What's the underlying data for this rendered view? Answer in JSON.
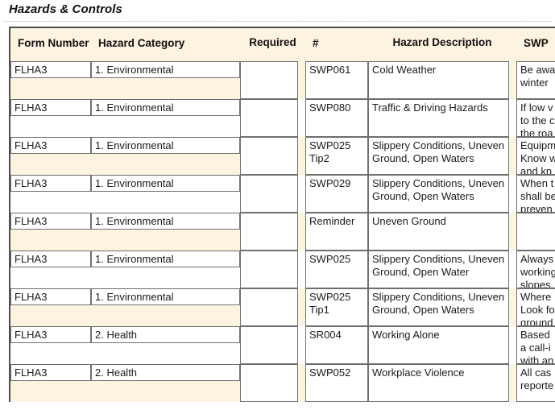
{
  "section": {
    "title": "Hazards & Controls"
  },
  "theme": {
    "header_background": "#FDF3E1",
    "band_background": "#FDF3E1",
    "cell_border": "#717171",
    "table_border": "#4F4F4F",
    "text": "#1B1B1B"
  },
  "table": {
    "columns": [
      {
        "key": "form_number",
        "label": "Form\nNumber",
        "align": "left"
      },
      {
        "key": "hazard_category",
        "label": "Hazard Category",
        "align": "left"
      },
      {
        "key": "required",
        "label": "Required",
        "align": "center"
      },
      {
        "key": "number",
        "label": "#",
        "align": "left"
      },
      {
        "key": "hazard_description",
        "label": "Hazard Description",
        "align": "center"
      },
      {
        "key": "swp",
        "label": "SWP",
        "align": "left"
      }
    ],
    "rows": [
      {
        "form_number": "FLHA3",
        "hazard_category": "1. Environmental",
        "required": "",
        "number": "SWP061",
        "hazard_description": "Cold Weather",
        "swp": "Be awa\nwinter "
      },
      {
        "form_number": "FLHA3",
        "hazard_category": "1. Environmental",
        "required": "",
        "number": "SWP080",
        "hazard_description": "Traffic & Driving Hazards",
        "swp": "If low v\nto the c\nthe roa"
      },
      {
        "form_number": "FLHA3",
        "hazard_category": "1. Environmental",
        "required": "",
        "number": "SWP025 Tip2",
        "hazard_description": "Slippery Conditions, Uneven Ground, Open Waters",
        "swp": "Equipm\nKnow w\nand kn"
      },
      {
        "form_number": "FLHA3",
        "hazard_category": "1. Environmental",
        "required": "",
        "number": "SWP029",
        "hazard_description": "Slippery Conditions, Uneven Ground, Open Waters",
        "swp": "When t\nshall be\npreven"
      },
      {
        "form_number": "FLHA3",
        "hazard_category": "1. Environmental",
        "required": "",
        "number": "Reminder",
        "hazard_description": "Uneven Ground",
        "swp": ""
      },
      {
        "form_number": "FLHA3",
        "hazard_category": "1. Environmental",
        "required": "",
        "number": "SWP025",
        "hazard_description": "Slippery Conditions, Uneven Ground, Open Water",
        "swp": "Always\nworking\nslopes."
      },
      {
        "form_number": "FLHA3",
        "hazard_category": "1. Environmental",
        "required": "",
        "number": "SWP025 Tip1",
        "hazard_description": "Slippery Conditions, Uneven Ground, Open Waters",
        "swp": "Where \nLook fo\nground"
      },
      {
        "form_number": "FLHA3",
        "hazard_category": "2. Health",
        "required": "",
        "number": "SR004",
        "hazard_description": "Working Alone",
        "swp": "Based \na call-i\nwith an"
      },
      {
        "form_number": "FLHA3",
        "hazard_category": "2. Health",
        "required": "",
        "number": "SWP052",
        "hazard_description": "Workplace Violence",
        "swp": "All cas\nreporte"
      }
    ]
  }
}
